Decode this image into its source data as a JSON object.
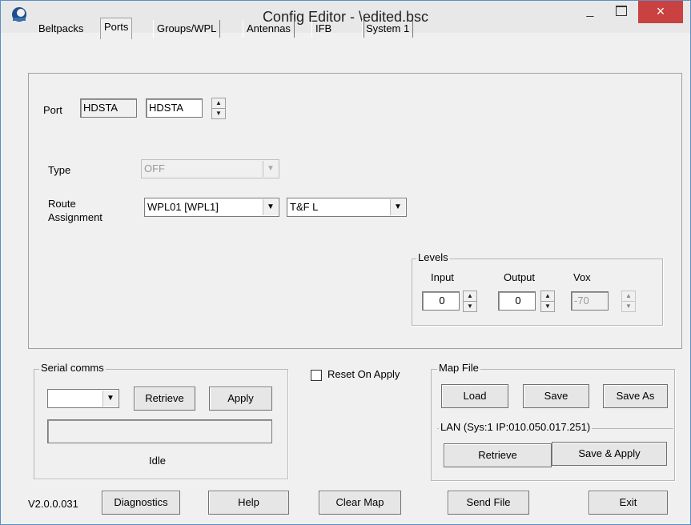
{
  "window": {
    "title": "Config Editor - \\edited.bsc",
    "minimize": "_",
    "close": "×"
  },
  "tabs": [
    "Beltpacks",
    "Ports",
    "Groups/WPL",
    "Antennas",
    "IFB",
    "System 1"
  ],
  "port": {
    "label": "Port",
    "value1": "HDSTA",
    "value2": "HDSTA"
  },
  "type": {
    "label": "Type",
    "value": "OFF"
  },
  "route": {
    "label_line1": "Route",
    "label_line2": "Assignment",
    "value1": "WPL01 [WPL1]",
    "value2": "T&F L"
  },
  "levels": {
    "title": "Levels",
    "input_label": "Input",
    "input_value": "0",
    "output_label": "Output",
    "output_value": "0",
    "vox_label": "Vox",
    "vox_value": "-70"
  },
  "serial": {
    "title": "Serial comms",
    "retrieve": "Retrieve",
    "apply": "Apply",
    "status": "Idle"
  },
  "reset_on_apply": "Reset On Apply",
  "mapfile": {
    "title": "Map File",
    "load": "Load",
    "save": "Save",
    "save_as": "Save As"
  },
  "lan": {
    "title": "LAN  (Sys:1 IP:010.050.017.251)",
    "retrieve": "Retrieve",
    "save_apply": "Save & Apply"
  },
  "bottom": {
    "version": "V2.0.0.031",
    "diagnostics": "Diagnostics",
    "help": "Help",
    "clear_map": "Clear Map",
    "send_file": "Send File",
    "exit": "Exit"
  }
}
